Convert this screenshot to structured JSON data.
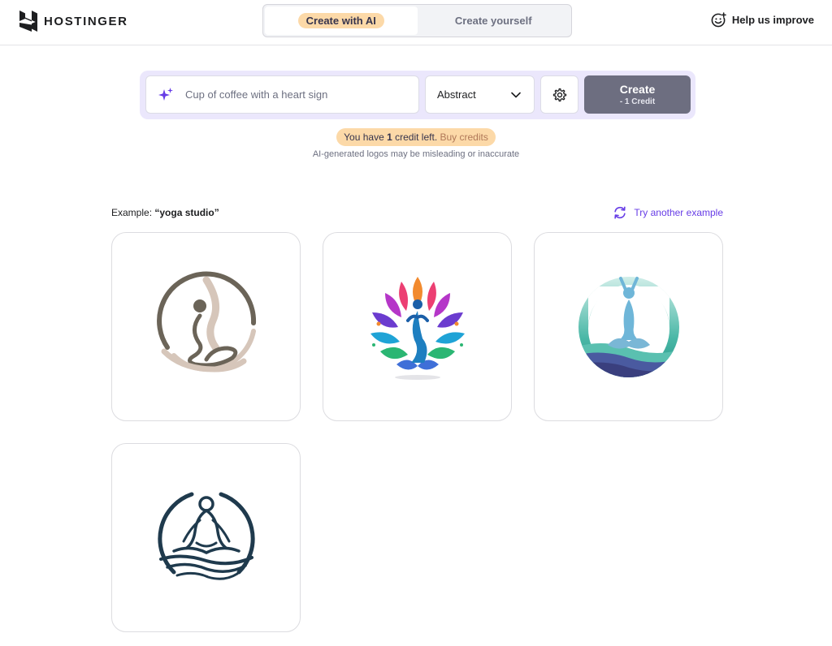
{
  "header": {
    "brand": "HOSTINGER",
    "tabs": [
      {
        "label": "Create with AI",
        "active": true
      },
      {
        "label": "Create yourself",
        "active": false
      }
    ],
    "help_label": "Help us improve"
  },
  "prompt": {
    "placeholder": "Cup of coffee with a heart sign",
    "style_value": "Abstract",
    "create_label": "Create",
    "create_cost": "- 1 Credit"
  },
  "credits": {
    "prefix": "You have ",
    "count": "1",
    "suffix": " credit left. ",
    "buy_label": "Buy credits",
    "disclaimer": "AI-generated logos may be misleading or inaccurate"
  },
  "example": {
    "prefix": "Example: ",
    "query": "“yoga studio”",
    "try_another_label": "Try another example",
    "logos": [
      {
        "icon": "yoga-circle-beige-logo"
      },
      {
        "icon": "yoga-lotus-colorful-logo"
      },
      {
        "icon": "yoga-teal-wave-logo"
      },
      {
        "icon": "yoga-navy-meditation-logo"
      }
    ]
  },
  "colors": {
    "accent": "#673de6",
    "highlight": "#fcd9a8",
    "create_button": "#6d6e80",
    "prompt_bg": "#ebe7fc"
  }
}
